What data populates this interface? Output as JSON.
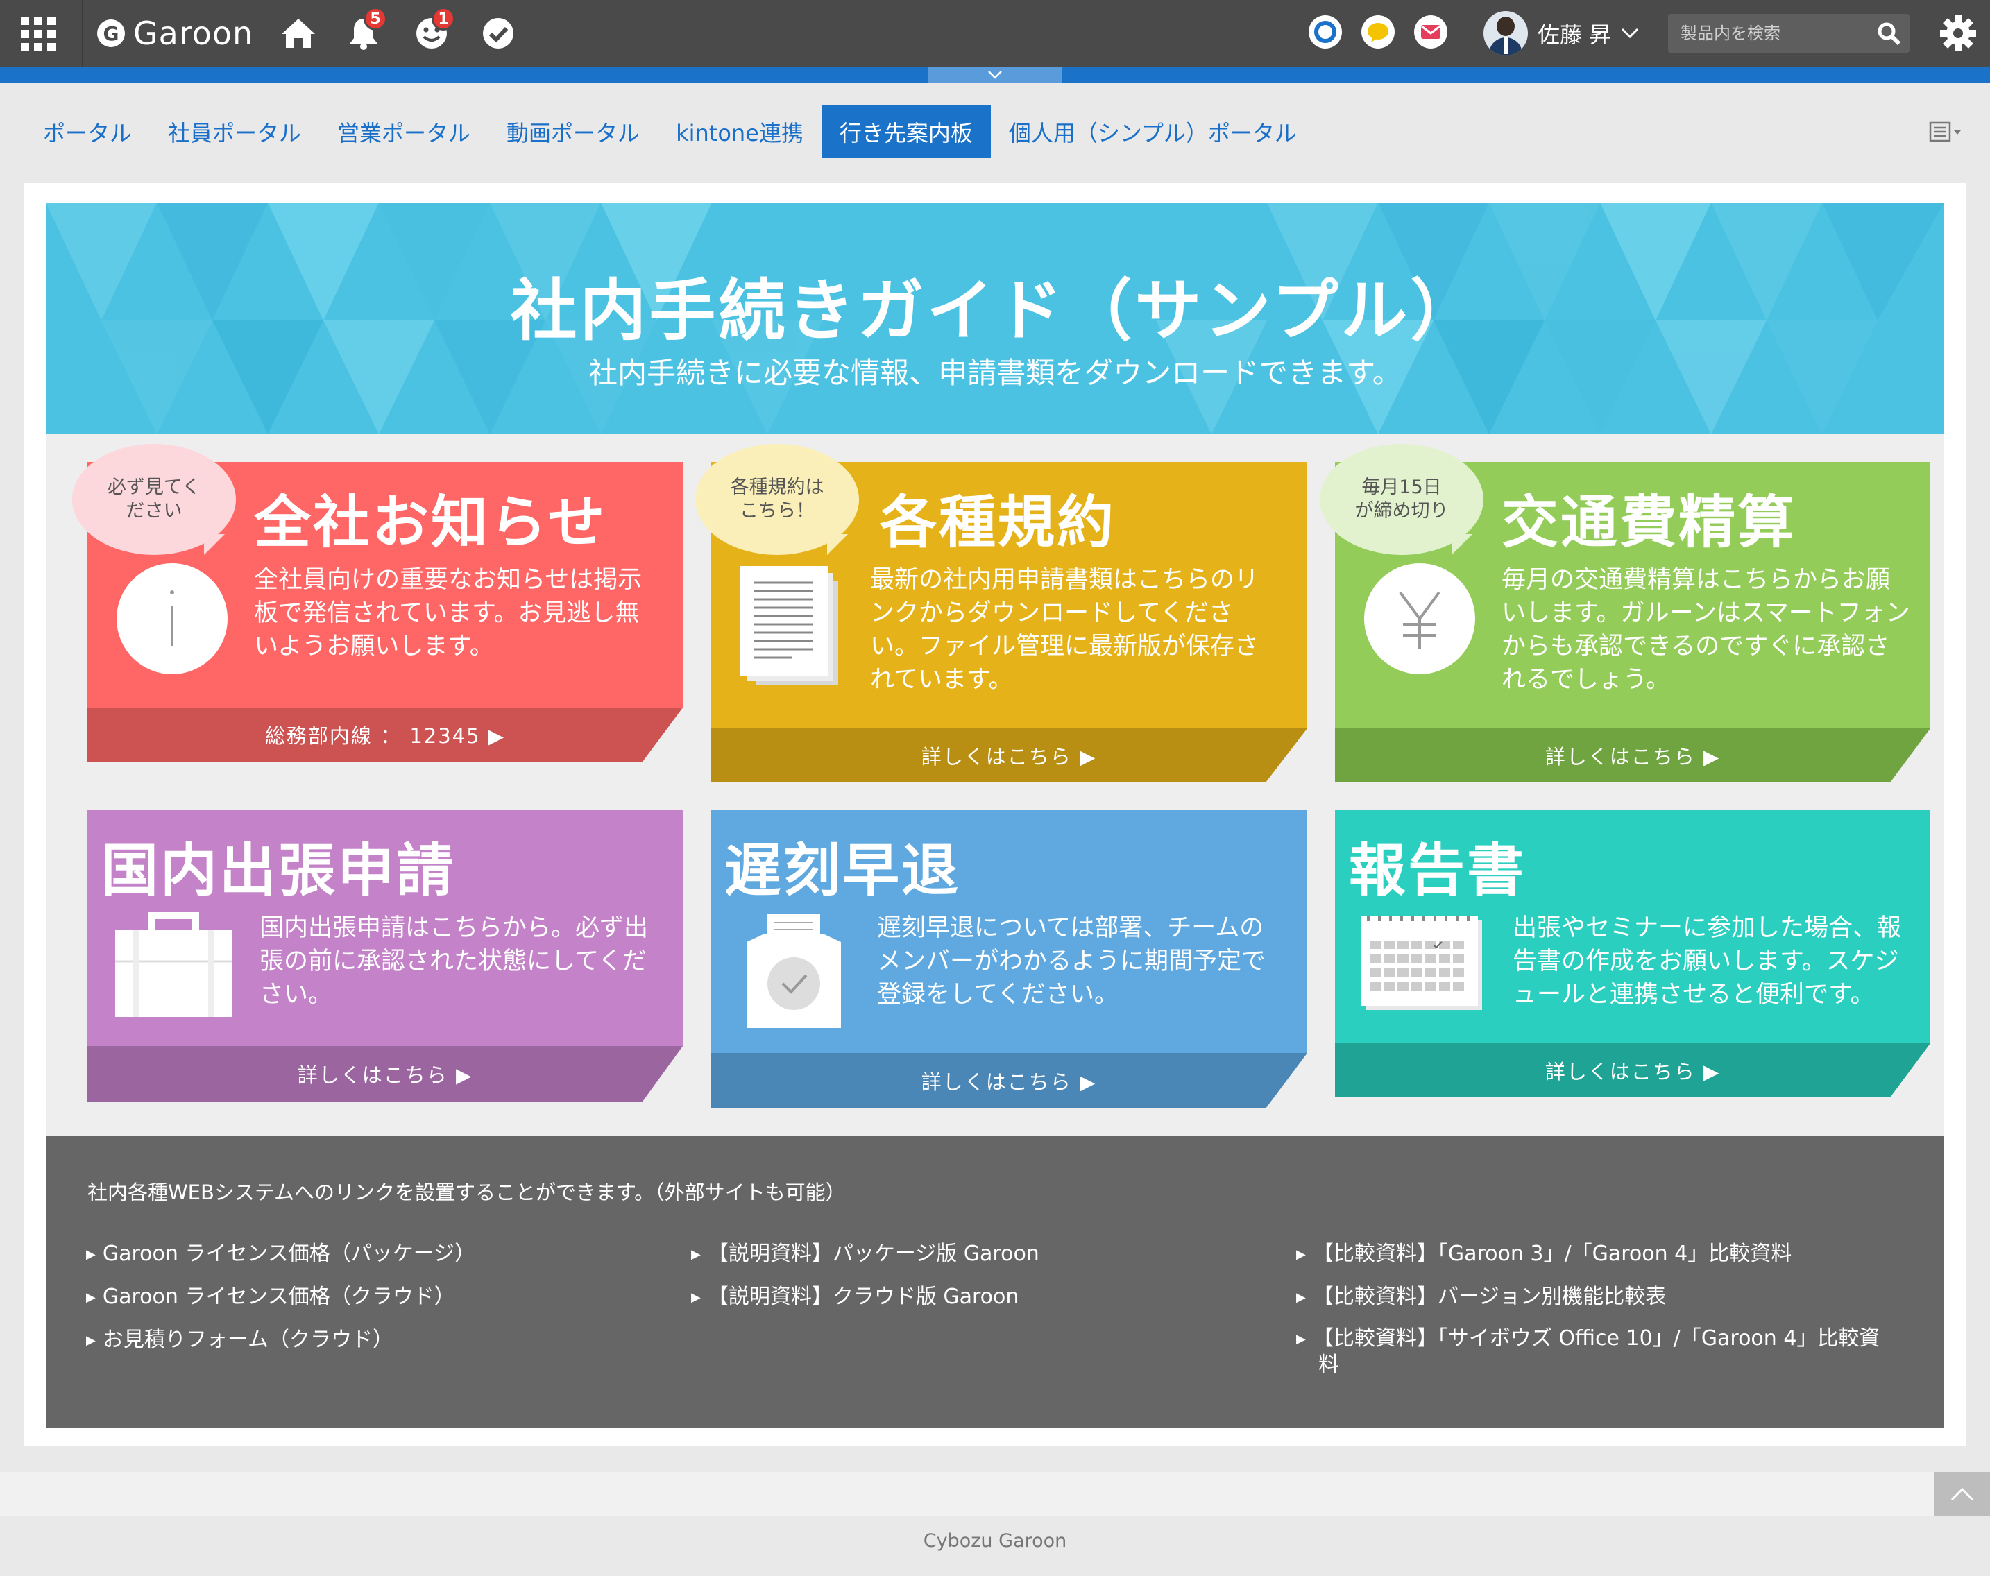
{
  "header": {
    "logo_letter": "G",
    "app_name": "Garoon",
    "notifications_count": "5",
    "reactions_count": "1",
    "user_name": "佐藤 昇",
    "search_placeholder": "製品内を検索"
  },
  "tabs": [
    {
      "label": "ポータル",
      "active": false
    },
    {
      "label": "社員ポータル",
      "active": false
    },
    {
      "label": "営業ポータル",
      "active": false
    },
    {
      "label": "動画ポータル",
      "active": false
    },
    {
      "label": "kintone連携",
      "active": false
    },
    {
      "label": "行き先案内板",
      "active": true
    },
    {
      "label": "個人用（シンプル）ポータル",
      "active": false
    }
  ],
  "hero": {
    "title": "社内手続きガイド（サンプル）",
    "subtitle": "社内手続きに必要な情報、申請書類をダウンロードできます。"
  },
  "tiles": [
    {
      "title": "全社お知らせ",
      "bubble": "必ず見てく\nださい",
      "desc": "全社員向けの重要なお知らせは掲示板で発信されています。お見逃し無いようお願いします。",
      "footer": "総務部内線 ： 12345 ▶",
      "icon": "info-icon",
      "color": "#ff6666"
    },
    {
      "title": "各種規約",
      "bubble": "各種規約は\nこちら！",
      "desc": "最新の社内用申請書類はこちらのリンクからダウンロードしてください。ファイル管理に最新版が保存されています。",
      "footer": "詳しくはこちら ▶",
      "icon": "document-icon",
      "color": "#e6b21a"
    },
    {
      "title": "交通費精算",
      "bubble": "毎月15日\nが締め切り",
      "desc": "毎月の交通費精算はこちらからお願いします。ガルーンはスマートフォンからも承認できるのですぐに承認されるでしょう。",
      "footer": "詳しくはこちら ▶",
      "icon": "yen-icon",
      "color": "#93cc58"
    },
    {
      "title": "国内出張申請",
      "desc": "国内出張申請はこちらから。必ず出張の前に承認された状態にしてください。",
      "footer": "詳しくはこちら ▶",
      "icon": "briefcase-icon",
      "color": "#c483c9"
    },
    {
      "title": "遅刻早退",
      "desc": "遅刻早退については部署、チームのメンバーがわかるように期間予定で登録をしてください。",
      "footer": "詳しくはこちら ▶",
      "icon": "clock-card-icon",
      "color": "#5fa9e0"
    },
    {
      "title": "報告書",
      "desc": "出張やセミナーに参加した場合、報告書の作成をお願いします。スケジュールと連携させると便利です。",
      "footer": "詳しくはこちら ▶",
      "icon": "calendar-icon",
      "color": "#2bcfc0"
    }
  ],
  "links": {
    "intro": "社内各種WEBシステムへのリンクを設置することができます。（外部サイトも可能）",
    "items": [
      "Garoon ライセンス価格（パッケージ）",
      "Garoon ライセンス価格（クラウド）",
      "お見積りフォーム（クラウド）",
      "【説明資料】パッケージ版 Garoon",
      "【説明資料】クラウド版 Garoon",
      "【比較資料】「Garoon 3」/「Garoon 4」比較資料",
      "【比較資料】バージョン別機能比較表",
      "【比較資料】「サイボウズ Office 10」/「Garoon 4」比較資",
      "料"
    ]
  },
  "footer": {
    "text": "Cybozu Garoon"
  }
}
